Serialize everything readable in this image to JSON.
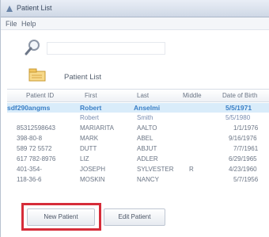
{
  "window": {
    "title": "Patient List"
  },
  "menu": {
    "file": "File",
    "help": "Help"
  },
  "list": {
    "title": "Patient List"
  },
  "columns": [
    "Patient ID",
    "First",
    "Last",
    "Middle",
    "Date of Birth"
  ],
  "rows": [
    {
      "id": "sdf290angms",
      "first": "Robert",
      "last": "Anselmi",
      "middle": "",
      "dob": "5/5/1971",
      "selected": true
    },
    {
      "id": "",
      "first": "Robert",
      "last": "Smith",
      "middle": "",
      "dob": "5/5/1980"
    },
    {
      "id": "85312598643",
      "first": "MARIARITA",
      "last": "AALTO",
      "middle": "",
      "dob": "1/1/1976"
    },
    {
      "id": "398-80-8",
      "first": "MARK",
      "last": "ABEL",
      "middle": "",
      "dob": "9/16/1976"
    },
    {
      "id": "589 72 5572",
      "first": "DUTT",
      "last": "ABJUT",
      "middle": "",
      "dob": "7/7/1961"
    },
    {
      "id": "617 782-8976",
      "first": "LIZ",
      "last": "ADLER",
      "middle": "",
      "dob": "6/29/1965"
    },
    {
      "id": "401-354-",
      "first": "JOSEPH",
      "last": "SYLVESTER",
      "middle": "R",
      "dob": "4/23/1960"
    },
    {
      "id": "118-36-6",
      "first": "MOSKIN",
      "last": "NANCY",
      "middle": "",
      "dob": "5/7/1956"
    }
  ],
  "buttons": {
    "new_patient": "New Patient",
    "edit_patient": "Edit Patient"
  },
  "colors": {
    "highlight": "#d62d3a",
    "selection": "#d9ecfa",
    "selected_text": "#3a7fc6"
  },
  "icons": {
    "search": "magnifier-icon",
    "list": "folder-list-icon",
    "app": "app-icon"
  }
}
